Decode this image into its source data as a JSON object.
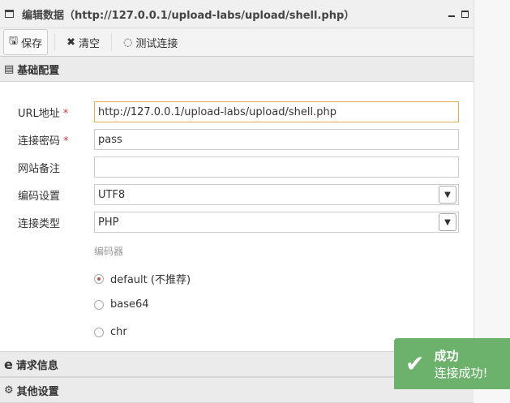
{
  "title": "编辑数据（http://127.0.0.1/upload-labs/upload/shell.php）",
  "toolbar": {
    "save": "保存",
    "clear": "清空",
    "test": "测试连接"
  },
  "sections": {
    "basic": "基础配置",
    "request": "请求信息",
    "other": "其他设置"
  },
  "form": {
    "url": {
      "label": "URL地址",
      "value": "http://127.0.0.1/upload-labs/upload/shell.php"
    },
    "password": {
      "label": "连接密码",
      "value": "pass"
    },
    "note": {
      "label": "网站备注",
      "value": ""
    },
    "encoding": {
      "label": "编码设置",
      "value": "UTF8"
    },
    "type": {
      "label": "连接类型",
      "value": "PHP"
    },
    "encoder": {
      "label": "编码器",
      "options": [
        "default (不推荐)",
        "base64",
        "chr"
      ],
      "selected": 0
    },
    "required_mark": "*"
  },
  "toast": {
    "title": "成功",
    "message": "连接成功!"
  }
}
